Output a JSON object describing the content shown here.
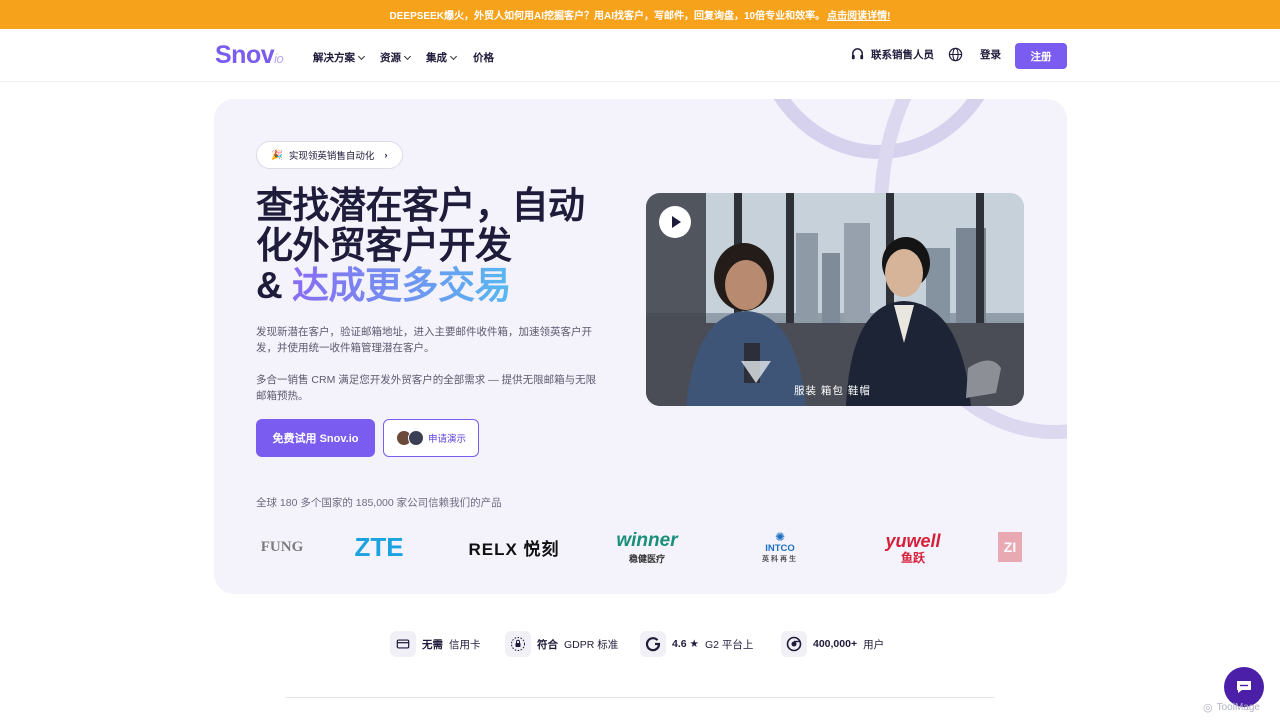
{
  "banner": {
    "text": "DEEPSEEK爆火，外贸人如何用AI挖掘客户？用AI找客户，写邮件，回复询盘，10倍专业和效率。",
    "link": "点击阅读详情!"
  },
  "nav": {
    "logo_main": "Snov",
    "logo_suffix": "io",
    "items": [
      {
        "label": "解决方案"
      },
      {
        "label": "资源"
      },
      {
        "label": "集成"
      },
      {
        "label": "价格"
      }
    ],
    "contact_sales": "联系销售人员",
    "login": "登录",
    "signup": "注册"
  },
  "hero": {
    "pill_icon": "🎉",
    "pill_text": "实现领英销售自动化",
    "title_line1": "查找潜在客户，自动",
    "title_line2": "化外贸客户开发",
    "title_line3_prefix": "& ",
    "title_line3_highlight": "达成更多交易",
    "desc1": "发现新潜在客户，验证邮箱地址，进入主要邮件收件箱，加速领英客户开发，并使用统一收件箱管理潜在客户。",
    "desc2": "多合一销售 CRM 满足您开发外贸客户的全部需求 — 提供无限邮箱与无限邮箱预热。",
    "cta_primary": "免费试用 Snov.io",
    "cta_demo": "申请演示",
    "trust_text": "全球 180 多个国家的 185,000 家公司信赖我们的产品",
    "video_subtitle": "服装 箱包 鞋帽",
    "logos": [
      "FUNG",
      "ZTE",
      "RELX 悦刻",
      "winner",
      "稳健医疗",
      "INTCO",
      "英科再生",
      "yuwell",
      "鱼跃",
      "ZI"
    ]
  },
  "badges": [
    {
      "strong": "无需",
      "text": "信用卡"
    },
    {
      "strong": "符合",
      "text": "GDPR 标准"
    },
    {
      "strong": "4.6 ★",
      "text": "G2 平台上"
    },
    {
      "strong": "400,000+",
      "text": "用户"
    }
  ],
  "watermark": "ToolMage",
  "colors": {
    "accent": "#7a5cf0",
    "banner": "#f7a21b",
    "hero_bg": "#f4f3fb",
    "zte": "#1aa3e0",
    "winner": "#1a8f7a",
    "yuwell": "#d6203a",
    "intco": "#1a6fc0"
  }
}
